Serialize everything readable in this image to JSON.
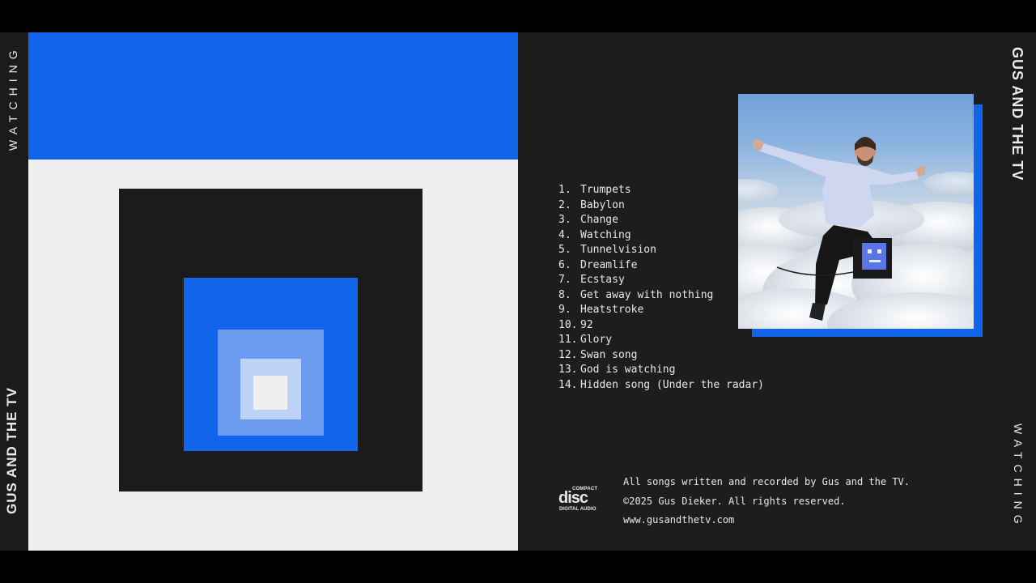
{
  "spine": {
    "left_title": "WATCHING",
    "left_band": "GUS AND THE TV",
    "right_band": "GUS AND THE TV",
    "right_title": "WATCHING"
  },
  "colors": {
    "accent_blue": "#1165ea",
    "light_blue": "#6b9cef",
    "pale_blue": "#bdd3f6",
    "off_white": "#efefef",
    "dark": "#1b1b1b"
  },
  "tracks": [
    {
      "num": "1.",
      "title": "Trumpets"
    },
    {
      "num": "2.",
      "title": "Babylon"
    },
    {
      "num": "3.",
      "title": "Change"
    },
    {
      "num": "4.",
      "title": "Watching"
    },
    {
      "num": "5.",
      "title": "Tunnelvision"
    },
    {
      "num": "6.",
      "title": "Dreamlife"
    },
    {
      "num": "7.",
      "title": "Ecstasy"
    },
    {
      "num": "8.",
      "title": "Get away with nothing"
    },
    {
      "num": "9.",
      "title": "Heatstroke"
    },
    {
      "num": "10.",
      "title": "92"
    },
    {
      "num": "11.",
      "title": "Glory"
    },
    {
      "num": "12.",
      "title": "Swan song"
    },
    {
      "num": "13.",
      "title": "God is watching"
    },
    {
      "num": "14.",
      "title": "Hidden song (Under the radar)"
    }
  ],
  "disc_logo": {
    "top": "COMPACT",
    "word": "disc",
    "bottom": "DIGITAL AUDIO"
  },
  "credits": {
    "line1": "All songs written and recorded by Gus and the TV.",
    "line2": "©2025 Gus Dieker. All rights reserved.",
    "line3": "www.gusandthetv.com"
  }
}
